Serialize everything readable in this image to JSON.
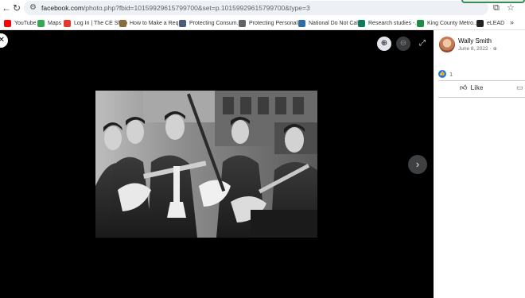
{
  "browser": {
    "url_host": "facebook.com",
    "url_rest": "/photo.php?fbid=10159929615799700&set=p.10159929615799700&type=3",
    "icons": {
      "back": "arrow-left-icon",
      "reload": "reload-icon",
      "tune": "site-settings-icon",
      "install": "install-app-icon",
      "star": "bookmark-star-icon"
    }
  },
  "bookmarks": {
    "items": [
      {
        "label": "YouTube",
        "icon": "youtube-icon",
        "color": "#ff0000"
      },
      {
        "label": "Maps",
        "icon": "maps-icon",
        "color": "#34a853"
      },
      {
        "label": "Log In | The CE Shop",
        "icon": "ce-shop-icon",
        "color": "#e03c31"
      },
      {
        "label": "How to Make a Req...",
        "icon": "page-icon",
        "color": "#8a6d3b"
      },
      {
        "label": "Protecting Consum...",
        "icon": "ftc-icon",
        "color": "#4a5a7a"
      },
      {
        "label": "Protecting Personal...",
        "icon": "globe-icon",
        "color": "#5f6368"
      },
      {
        "label": "National Do Not Cal...",
        "icon": "dnc-icon",
        "color": "#2e6da4"
      },
      {
        "label": "Research studies -...",
        "icon": "research-icon",
        "color": "#0f7b5a"
      },
      {
        "label": "King County Metro...",
        "icon": "metro-icon",
        "color": "#1e8c45"
      },
      {
        "label": "eLEAD",
        "icon": "elead-icon",
        "color": "#222222"
      }
    ],
    "more": "»"
  },
  "viewer": {
    "photo_alt": "Black and white photo of five young musicians with guitars and a trumpet",
    "icons": {
      "close": "close-icon",
      "zoom_in": "zoom-in-icon",
      "zoom_out": "zoom-out-icon",
      "fullscreen": "fullscreen-icon",
      "next": "chevron-right-icon"
    }
  },
  "post": {
    "author": "Wally Smith",
    "date": "June 8, 2022",
    "separator": "·",
    "reaction_count": "1",
    "like_label": "Like"
  },
  "colors": {
    "fb_blue": "#1877f2",
    "viewer_bg": "#000000"
  }
}
